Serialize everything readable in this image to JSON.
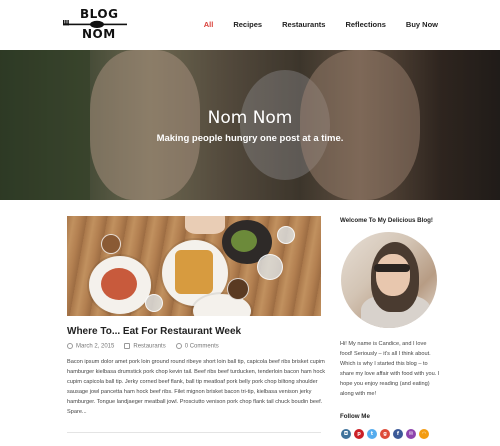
{
  "site": {
    "logo_top": "BLOG",
    "logo_bottom": "NOM",
    "nav": [
      {
        "label": "All",
        "active": true
      },
      {
        "label": "Recipes",
        "active": false
      },
      {
        "label": "Restaurants",
        "active": false
      },
      {
        "label": "Reflections",
        "active": false
      },
      {
        "label": "Buy Now",
        "active": false
      }
    ],
    "accent_color": "#d9403a"
  },
  "hero": {
    "title": "Nom Nom",
    "subtitle": "Making people hungry one post at a time."
  },
  "post": {
    "title": "Where To... Eat For Restaurant Week",
    "date": "March 2, 2015",
    "category": "Restaurants",
    "comments": "0 Comments",
    "excerpt": "Bacon ipsum dolor amet pork loin ground round ribeye short loin ball tip, capicola beef ribs brisket cupim hamburger kielbasa drumstick pork chop kevin tail. Beef ribs beef turducken, tenderloin bacon ham hock cupim capicola ball tip. Jerky corned beef flank, ball tip meatloaf pork belly pork chop biltong shoulder sausage jowl pancetta ham hock beef ribs. Filet mignon brisket bacon tri-tip, kielbasa venison jerky hamburger. Tongue landjaeger meatball jowl. Prosciutto venison pork chop flank tail chuck boudin beef. Spare..."
  },
  "sidebar": {
    "welcome_title": "Welcome To My Delicious Blog!",
    "bio": "Hi! My name is Candice, and I love food! Seriously – it’s all I think about. Which is why I started this blog – to share my love affair with food with you. I hope you enjoy reading (and eating) along with me!",
    "follow_title": "Follow Me",
    "social_icons": [
      {
        "icon": "instagram-icon",
        "color": "#3f729b"
      },
      {
        "icon": "pinterest-icon",
        "color": "#cb2027"
      },
      {
        "icon": "twitter-icon",
        "color": "#55acee"
      },
      {
        "icon": "google-plus-icon",
        "color": "#dd4b39"
      },
      {
        "icon": "facebook-icon",
        "color": "#3b5998"
      },
      {
        "icon": "email-icon",
        "color": "#8e44ad"
      },
      {
        "icon": "rss-icon",
        "color": "#f39c12"
      }
    ]
  }
}
